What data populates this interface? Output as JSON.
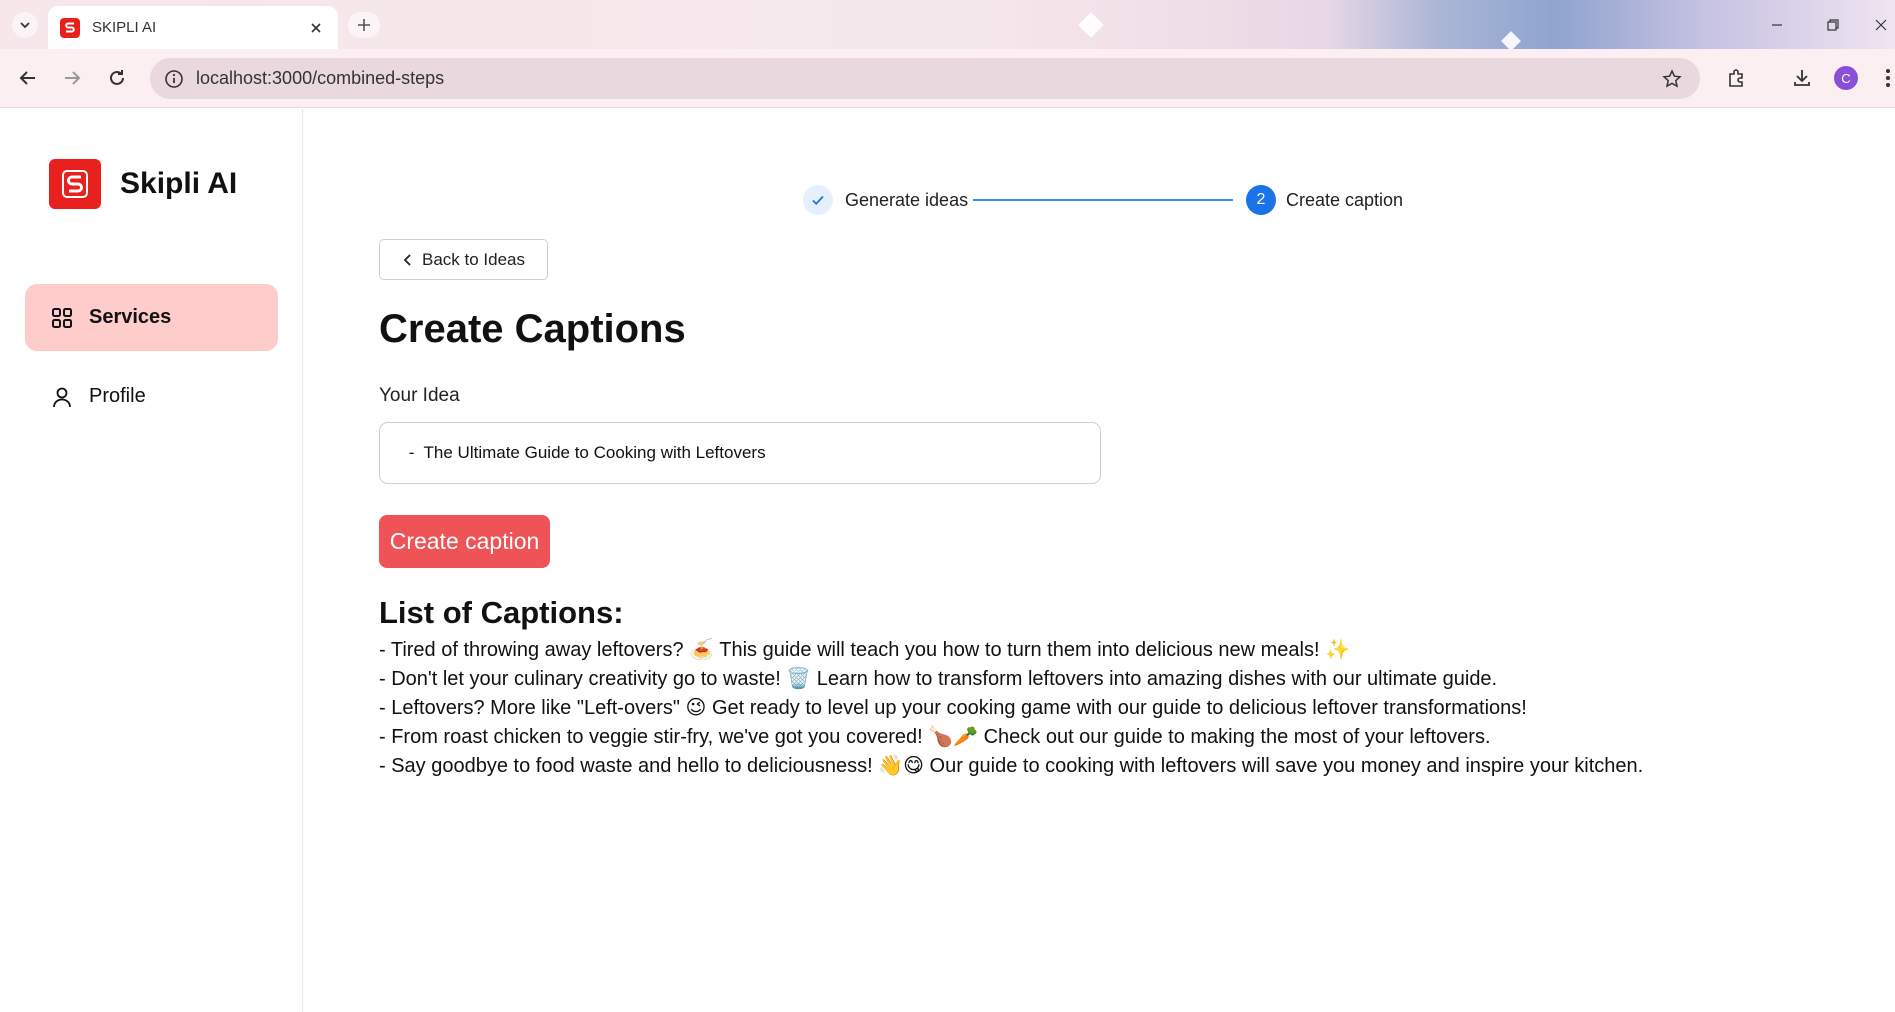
{
  "browser": {
    "tab_title": "SKIPLI AI",
    "url": "localhost:3000/combined-steps",
    "profile_initial": "C"
  },
  "sidebar": {
    "brand_name": "Skipli AI",
    "items": [
      {
        "label": "Services",
        "icon": "grid-icon",
        "active": true
      },
      {
        "label": "Profile",
        "icon": "user-icon",
        "active": false
      }
    ]
  },
  "stepper": {
    "steps": [
      {
        "label": "Generate ideas",
        "status": "done"
      },
      {
        "number": "2",
        "label": "Create caption",
        "status": "current"
      }
    ]
  },
  "main": {
    "back_label": "Back to Ideas",
    "title": "Create Captions",
    "idea_label": "Your Idea",
    "idea_value": " -  The Ultimate Guide to Cooking with Leftovers",
    "create_label": "Create caption",
    "list_title": "List of Captions:",
    "captions": [
      "- Tired of throwing away leftovers? 🍝 This guide will teach you how to turn them into delicious new meals! ✨",
      "- Don't let your culinary creativity go to waste! 🗑️ Learn how to transform leftovers into amazing dishes with our ultimate guide.",
      "- Leftovers? More like \"Left-overs\" 😉 Get ready to level up your cooking game with our guide to delicious leftover transformations!",
      "- From roast chicken to veggie stir-fry, we've got you covered! 🍗🥕 Check out our guide to making the most of your leftovers.",
      "- Say goodbye to food waste and hello to deliciousness! 👋😋 Our guide to cooking with leftovers will save you money and inspire your kitchen."
    ]
  },
  "colors": {
    "brand_red": "#e8211d",
    "active_nav": "#ffcccc",
    "create_button": "#ee5457",
    "stepper_blue": "#1a73e8"
  }
}
